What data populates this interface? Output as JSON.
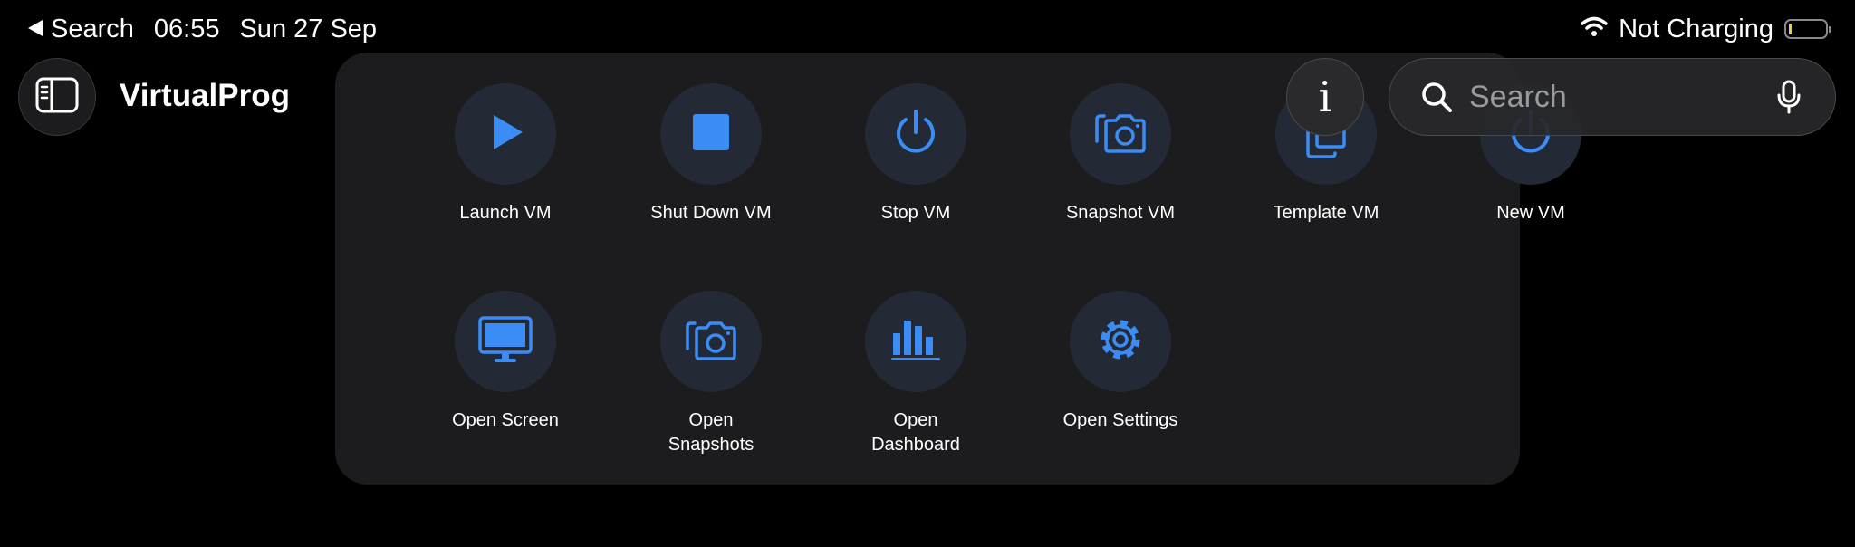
{
  "status_bar": {
    "back_label": "Search",
    "time": "06:55",
    "date": "Sun 27 Sep",
    "charging": "Not Charging",
    "wifi_icon": "wifi-icon",
    "battery_icon": "battery-icon"
  },
  "nav": {
    "sidebar_icon": "sidebar-icon",
    "title": "VirtualProg",
    "info_glyph": "i",
    "search_placeholder": "Search",
    "mic_icon": "microphone-icon"
  },
  "actions": [
    {
      "label": "Launch VM",
      "icon": "play-icon"
    },
    {
      "label": "Shut Down VM",
      "icon": "stop-square-icon"
    },
    {
      "label": "Stop VM",
      "icon": "power-icon"
    },
    {
      "label": "Snapshot VM",
      "icon": "camera-stack-icon"
    },
    {
      "label": "Template VM",
      "icon": "document-copy-icon"
    },
    {
      "label": "New VM",
      "icon": "power-icon"
    },
    {
      "label": "Open Screen",
      "icon": "display-icon"
    },
    {
      "label": "Open Snapshots",
      "icon": "camera-stack-icon"
    },
    {
      "label": "Open Dashboard",
      "icon": "bar-chart-icon"
    },
    {
      "label": "Open Settings",
      "icon": "gear-icon"
    }
  ],
  "colors": {
    "accent": "#3b8cf5",
    "icon_circle": "#232a36",
    "panel": "#1c1c1e",
    "background": "#000000"
  }
}
